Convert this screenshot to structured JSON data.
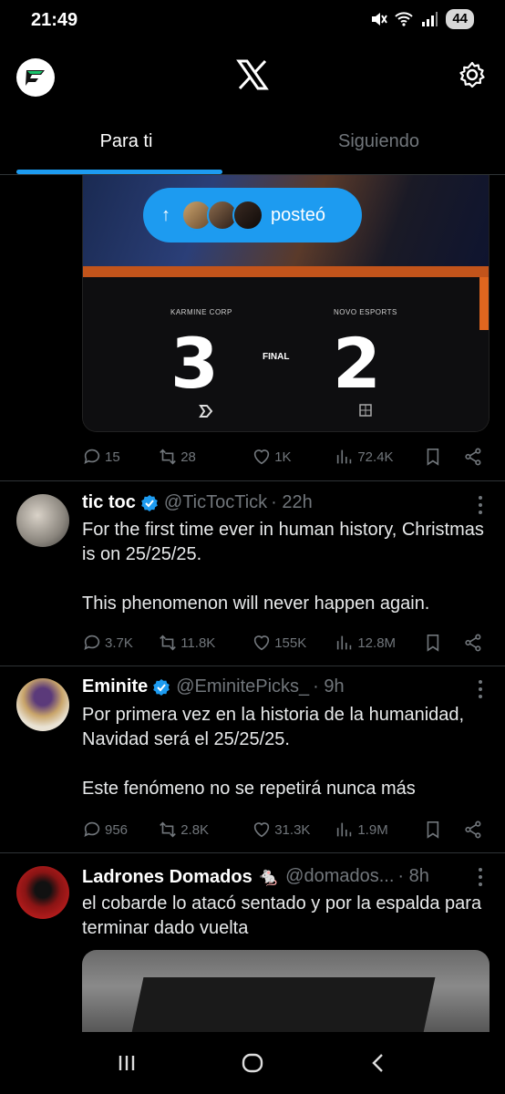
{
  "status_bar": {
    "time": "21:49",
    "battery": "44"
  },
  "tabs": [
    {
      "label": "Para ti"
    },
    {
      "label": "Siguiendo"
    }
  ],
  "posted_pill": {
    "label": "posteó"
  },
  "first_post": {
    "scoreboard": {
      "team_left": "KARMINE CORP",
      "team_right": "NOVO ESPORTS",
      "score_left": "3",
      "score_right": "2",
      "status": "FINAL"
    },
    "replies": "15",
    "reposts": "28",
    "likes": "1K",
    "views": "72.4K"
  },
  "tweets": [
    {
      "name": "tic toc",
      "handle": "@TicTocTick",
      "time": "· 22h",
      "text": "For the first time ever in human history, Christmas is on 25/25/25.\n\nThis phenomenon will never happen again.",
      "replies": "3.7K",
      "reposts": "11.8K",
      "likes": "155K",
      "views": "12.8M"
    },
    {
      "name": "Eminite",
      "handle": "@EminitePicks_",
      "time": "· 9h",
      "text": "Por primera vez en la historia de la humanidad, Navidad será el 25/25/25.\n\nEste fenómeno no se repetirá nunca más",
      "replies": "956",
      "reposts": "2.8K",
      "likes": "31.3K",
      "views": "1.9M"
    },
    {
      "name": "Ladrones Domados 🐁",
      "handle": "@domados...",
      "time": "· 8h",
      "text": "el cobarde lo atacó sentado y por la espalda para terminar dado vuelta"
    }
  ],
  "colors": {
    "accent": "#1d9bf0",
    "background": "#000000",
    "muted": "#71767b"
  }
}
